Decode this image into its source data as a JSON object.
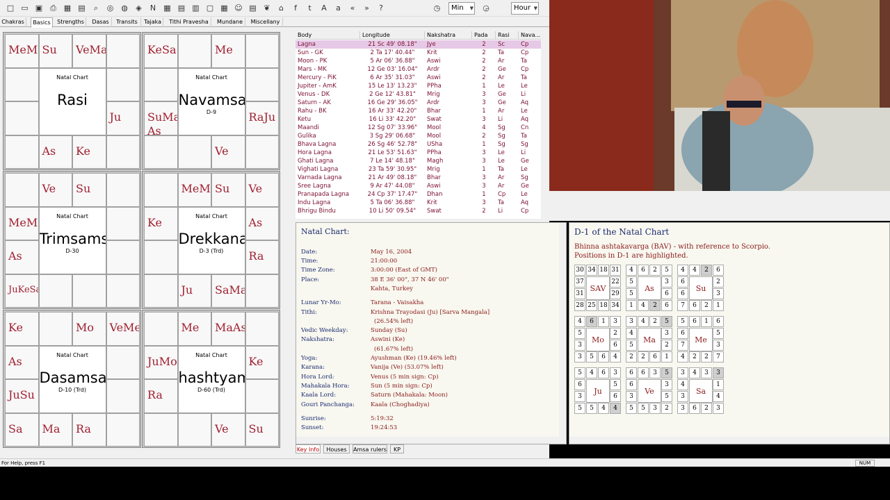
{
  "toolbar": {
    "zoom_min": "Min",
    "zoom_hour": "Hour",
    "icons": [
      "new-icon",
      "open-icon",
      "save-icon",
      "print-icon",
      "chart-icon",
      "data-icon",
      "search-icon",
      "sphere-icon",
      "sp-icon",
      "tool-icon",
      "n-icon",
      "grid-icon",
      "table-icon",
      "sb-icon",
      "frame-icon",
      "grid2-icon",
      "people-icon",
      "book-icon",
      "tree-icon",
      "house-icon",
      "facebook-icon",
      "twitter-icon",
      "font-large-icon",
      "font-small-icon",
      "prev-icon",
      "next-icon",
      "help-icon",
      "clock-icon",
      "clock2-icon"
    ]
  },
  "tabs": [
    "Chakras",
    "Basics",
    "Strengths",
    "Dasas",
    "Transits",
    "Tajaka",
    "Tithi Pravesha",
    "Mundane",
    "Miscellany"
  ],
  "charts": [
    {
      "name": "Rasi",
      "title": "Natal Chart",
      "sub": ""
    },
    {
      "name": "Navamsa",
      "title": "Natal Chart",
      "sub": "D-9"
    },
    {
      "name": "Trimsamsa",
      "title": "Natal Chart",
      "sub": "D-30"
    },
    {
      "name": "Drekkana",
      "title": "Natal Chart",
      "sub": "D-3 (Trd)"
    },
    {
      "name": "Dasamsa",
      "title": "Natal Chart",
      "sub": "D-10 (Trd)"
    },
    {
      "name": "hashtyams",
      "title": "Natal Chart",
      "sub": "D-60 (Trd)"
    }
  ],
  "table": {
    "headers": [
      "Body",
      "Longitude",
      "Nakshatra",
      "Pada",
      "Rasi",
      "Nava..."
    ],
    "rows": [
      [
        "Lagna",
        "21 Sc 49' 08.18\"",
        "Jye",
        "2",
        "Sc",
        "Cp"
      ],
      [
        "Sun - GK",
        "2 Ta 17' 40.44\"",
        "Krit",
        "2",
        "Ta",
        "Cp"
      ],
      [
        "Moon - PK",
        "5 Ar 06' 36.88\"",
        "Aswi",
        "2",
        "Ar",
        "Ta"
      ],
      [
        "Mars - MK",
        "12 Ge 03' 16.04\"",
        "Ardr",
        "2",
        "Ge",
        "Cp"
      ],
      [
        "Mercury - PiK",
        "6 Ar 35' 31.03\"",
        "Aswi",
        "2",
        "Ar",
        "Ta"
      ],
      [
        "Jupiter - AmK",
        "15 Le 13' 13.23\"",
        "PPha",
        "1",
        "Le",
        "Le"
      ],
      [
        "Venus - DK",
        "2 Ge 12' 43.81\"",
        "Mrig",
        "3",
        "Ge",
        "Li"
      ],
      [
        "Saturn - AK",
        "16 Ge 29' 36.05\"",
        "Ardr",
        "3",
        "Ge",
        "Aq"
      ],
      [
        "Rahu - BK",
        "16 Ar 33' 42.20\"",
        "Bhar",
        "1",
        "Ar",
        "Le"
      ],
      [
        "Ketu",
        "16 Li 33' 42.20\"",
        "Swat",
        "3",
        "Li",
        "Aq"
      ],
      [
        "Maandi",
        "12 Sg 07' 33.96\"",
        "Mool",
        "4",
        "Sg",
        "Cn"
      ],
      [
        "Gulika",
        "3 Sg 29' 06.68\"",
        "Mool",
        "2",
        "Sg",
        "Ta"
      ],
      [
        "Bhava Lagna",
        "26 Sg 46' 52.78\"",
        "USha",
        "1",
        "Sg",
        "Sg"
      ],
      [
        "Hora Lagna",
        "21 Le 53' 51.63\"",
        "PPha",
        "3",
        "Le",
        "Li"
      ],
      [
        "Ghati Lagna",
        "7 Le 14' 48.18\"",
        "Magh",
        "3",
        "Le",
        "Ge"
      ],
      [
        "Vighati Lagna",
        "23 Ta 59' 30.95\"",
        "Mrig",
        "1",
        "Ta",
        "Le"
      ],
      [
        "Varnada Lagna",
        "21 Ar 49' 08.18\"",
        "Bhar",
        "3",
        "Ar",
        "Sg"
      ],
      [
        "Sree Lagna",
        "9 Ar 47' 44.08\"",
        "Aswi",
        "3",
        "Ar",
        "Ge"
      ],
      [
        "Pranapada Lagna",
        "24 Cp 37' 17.47\"",
        "Dhan",
        "1",
        "Cp",
        "Le"
      ],
      [
        "Indu Lagna",
        "5 Ta 06' 36.88\"",
        "Krit",
        "3",
        "Ta",
        "Aq"
      ],
      [
        "Bhrigu Bindu",
        "10 Li 50' 09.54\"",
        "Swat",
        "2",
        "Li",
        "Cp"
      ]
    ]
  },
  "keyinfo": {
    "title": "Natal Chart:",
    "items": [
      {
        "k": "Date:",
        "v": "May 16, 2004"
      },
      {
        "k": "Time:",
        "v": "21:00:00"
      },
      {
        "k": "Time Zone:",
        "v": "3:00:00 (East of GMT)"
      },
      {
        "k": "Place:",
        "v": "38 E 36' 00\", 37 N 46' 00\""
      },
      {
        "k": "",
        "v": "Kahta, Turkey"
      },
      {
        "k": "Lunar Yr-Mo:",
        "v": "Tarana - Vaisakha"
      },
      {
        "k": "Tithi:",
        "v": "Krishna Trayodasi (Ju) [Sarva Mangala]"
      },
      {
        "k": "",
        "v": "(26.54% left)"
      },
      {
        "k": "Vedic Weekday:",
        "v": "Sunday (Su)"
      },
      {
        "k": "Nakshatra:",
        "v": "Aswini (Ke)"
      },
      {
        "k": "",
        "v": "(61.67% left)"
      },
      {
        "k": "Yoga:",
        "v": "Ayushman (Ke) (19.46% left)"
      },
      {
        "k": "Karana:",
        "v": "Vanija (Ve) (53.07% left)"
      },
      {
        "k": "Hora Lord:",
        "v": "Venus (5 min sign: Cp)"
      },
      {
        "k": "Mahakala Hora:",
        "v": "Sun (5 min sign: Cp)"
      },
      {
        "k": "Kaala Lord:",
        "v": "Saturn (Mahakala: Moon)"
      },
      {
        "k": "Gouri Panchanga:",
        "v": "Kaala (Choghadiya)"
      },
      {
        "k": "Sunrise:",
        "v": "5:19:32"
      },
      {
        "k": "Sunset:",
        "v": "19:24:53"
      }
    ]
  },
  "bav": {
    "title": "D-1 of the Natal Chart",
    "desc1": "Bhinna ashtakavarga (BAV) - with reference to Scorpio.",
    "desc2": "Positions in D-1 are highlighted.",
    "grids": [
      {
        "label": "SAV",
        "nums": [
          "30",
          "34",
          "18",
          "31",
          "22",
          "29",
          "34",
          "18",
          "25",
          "28",
          "31",
          "37"
        ],
        "hl": []
      },
      {
        "label": "As",
        "nums": [
          "4",
          "6",
          "2",
          "5",
          "3",
          "6",
          "6",
          "2",
          "4",
          "1",
          "5",
          "5"
        ],
        "hl": [
          7
        ]
      },
      {
        "label": "Su",
        "nums": [
          "4",
          "4",
          "2",
          "6",
          "2",
          "3",
          "1",
          "2",
          "6",
          "7",
          "6",
          "6"
        ],
        "hl": [
          2
        ]
      },
      {
        "label": "Mo",
        "nums": [
          "4",
          "6",
          "1",
          "3",
          "2",
          "6",
          "4",
          "6",
          "5",
          "3",
          "3",
          "5"
        ],
        "hl": [
          1
        ]
      },
      {
        "label": "Ma",
        "nums": [
          "3",
          "4",
          "2",
          "5",
          "3",
          "2",
          "1",
          "6",
          "2",
          "2",
          "5",
          "4"
        ],
        "hl": [
          3
        ]
      },
      {
        "label": "Me",
        "nums": [
          "5",
          "6",
          "1",
          "6",
          "5",
          "3",
          "7",
          "2",
          "2",
          "4",
          "7",
          "6"
        ],
        "hl": []
      },
      {
        "label": "Ju",
        "nums": [
          "5",
          "4",
          "6",
          "3",
          "5",
          "6",
          "4",
          "4",
          "5",
          "5",
          "3",
          "6"
        ],
        "hl": [
          6
        ]
      },
      {
        "label": "Ve",
        "nums": [
          "6",
          "6",
          "3",
          "5",
          "3",
          "5",
          "2",
          "3",
          "5",
          "5",
          "3",
          "6"
        ],
        "hl": [
          3
        ]
      },
      {
        "label": "Sa",
        "nums": [
          "3",
          "4",
          "3",
          "3",
          "1",
          "4",
          "3",
          "2",
          "6",
          "3",
          "3",
          "4"
        ],
        "hl": [
          3
        ]
      }
    ]
  },
  "bottomtabs": [
    "Key Info",
    "Houses",
    "Amsa rulers",
    "KP"
  ],
  "status": {
    "help": "For Help, press F1",
    "num": "NUM"
  }
}
